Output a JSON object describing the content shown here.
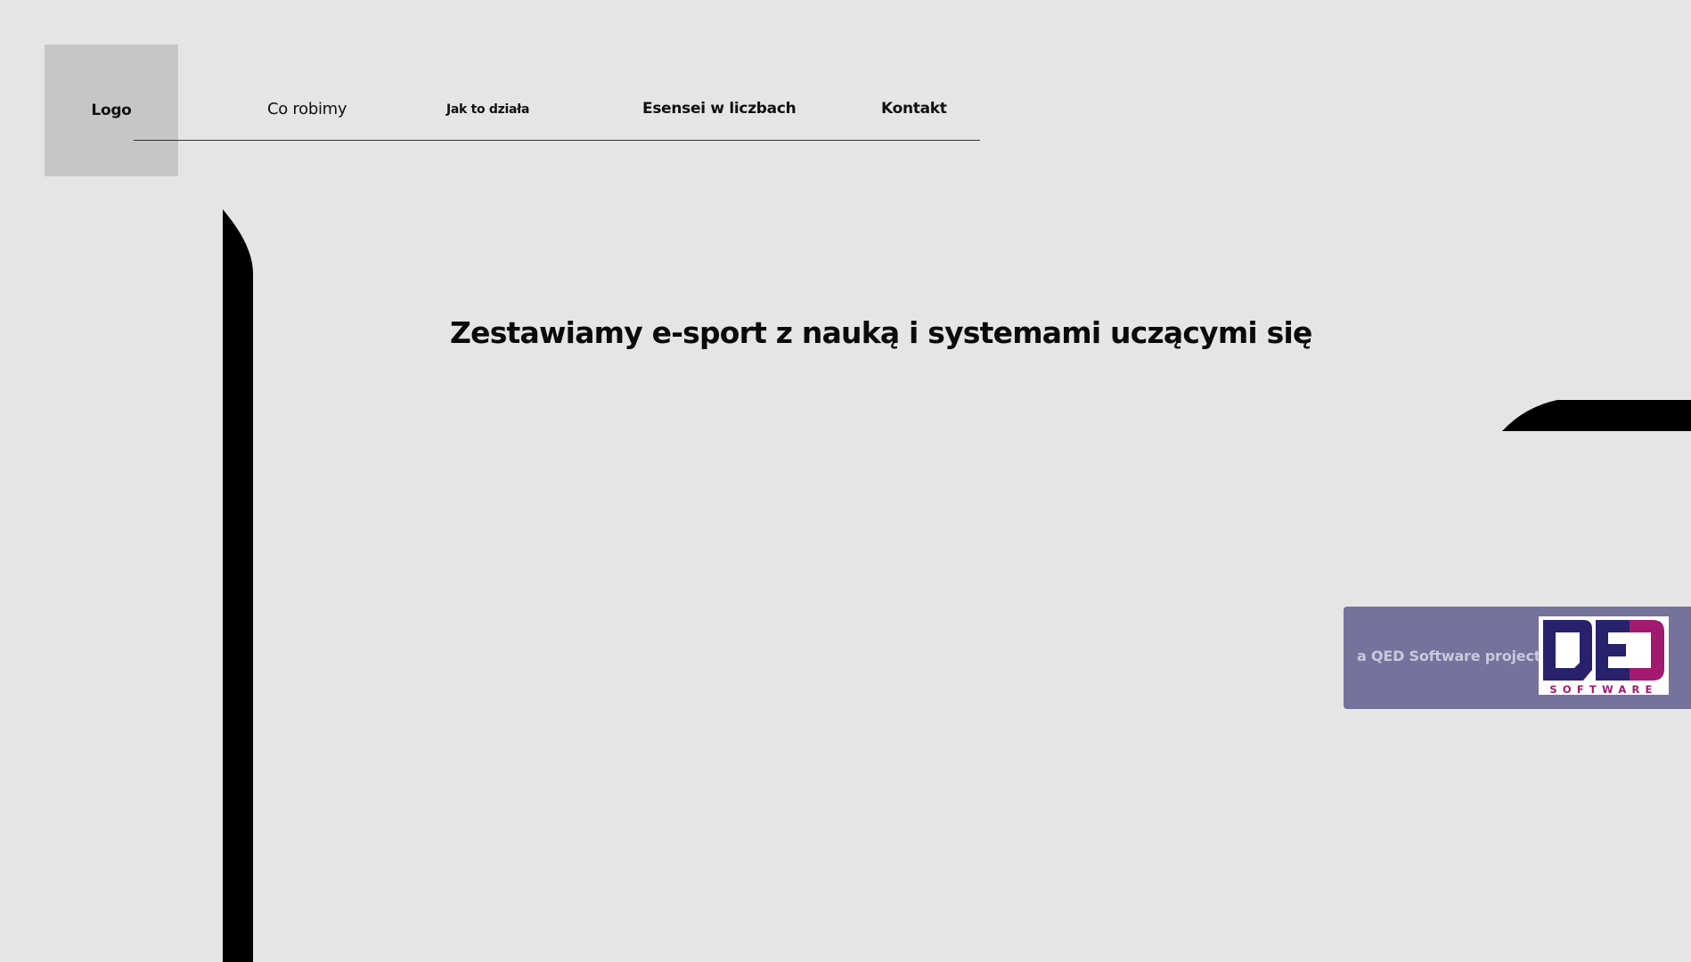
{
  "header": {
    "logo_label": "Logo",
    "nav": [
      {
        "label": "Co robimy"
      },
      {
        "label": "Jak to działa"
      },
      {
        "label": "Esensei w liczbach"
      },
      {
        "label": "Kontakt"
      }
    ]
  },
  "hero": {
    "title": "Zestawiamy e-sport z nauką i systemami uczącymi się"
  },
  "qed_banner": {
    "text": "a QED Software project.",
    "logo_letters": "QED",
    "logo_sub": "SOFTWARE",
    "colors": {
      "background": "#75739c",
      "logo_navy": "#28216b",
      "logo_magenta": "#a3196f"
    }
  }
}
